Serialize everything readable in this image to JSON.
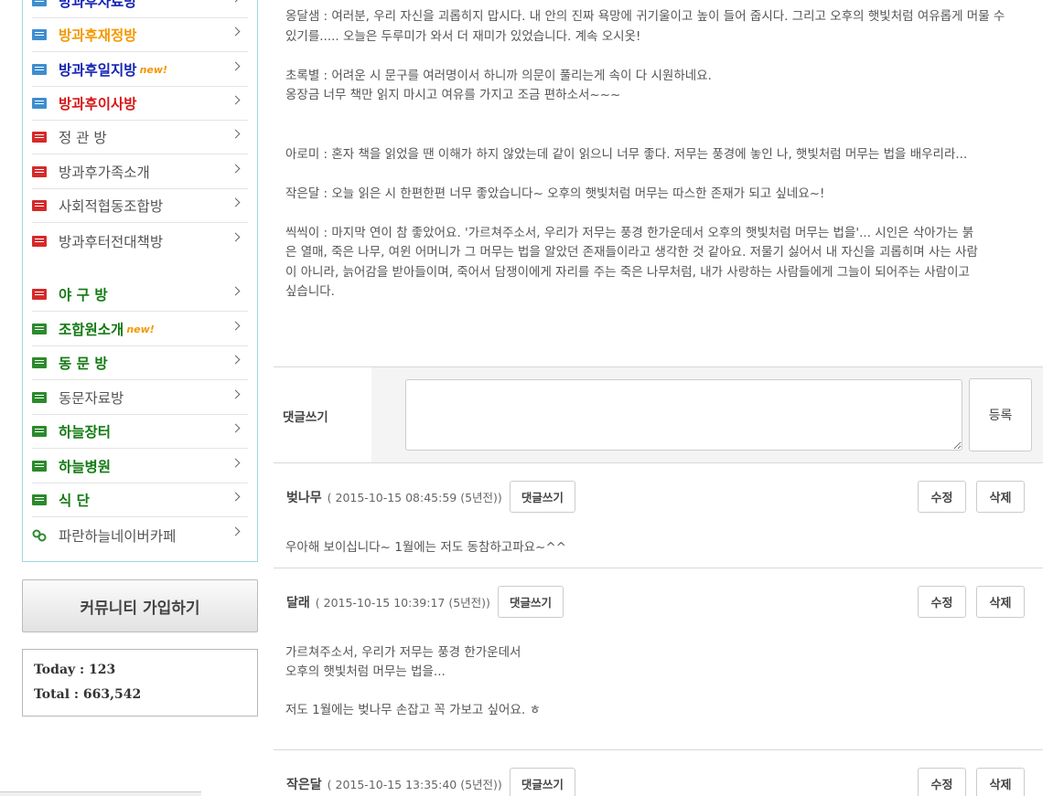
{
  "sidebar": {
    "items": [
      {
        "label": "방과후자료방",
        "style": "c-blue",
        "bold": true,
        "icon": "blue"
      },
      {
        "label": "방과후재정방",
        "style": "c-orange",
        "bold": true,
        "icon": "blue"
      },
      {
        "label": "방과후일지방",
        "style": "c-blue",
        "bold": true,
        "icon": "blue",
        "badge": "new!"
      },
      {
        "label": "방과후이사방",
        "style": "c-red",
        "bold": true,
        "icon": "blue"
      },
      {
        "label": "정 관 방",
        "style": "c-gray",
        "bold": false,
        "icon": "red"
      },
      {
        "label": "방과후가족소개",
        "style": "c-gray",
        "bold": false,
        "icon": "red"
      },
      {
        "label": "사회적협동조합방",
        "style": "c-gray",
        "bold": false,
        "icon": "red"
      },
      {
        "label": "방과후터전대책방",
        "style": "c-gray",
        "bold": false,
        "icon": "red"
      },
      {
        "label": "야 구 방",
        "style": "c-green",
        "bold": true,
        "icon": "red"
      },
      {
        "label": "조합원소개",
        "style": "c-green",
        "bold": true,
        "icon": "green",
        "badge": "new!"
      },
      {
        "label": "동 문 방",
        "style": "c-green",
        "bold": true,
        "icon": "green"
      },
      {
        "label": "동문자료방",
        "style": "c-gray",
        "bold": false,
        "icon": "green"
      },
      {
        "label": "하늘장터",
        "style": "c-green",
        "bold": true,
        "icon": "green"
      },
      {
        "label": "하늘병원",
        "style": "c-green",
        "bold": true,
        "icon": "green"
      },
      {
        "label": "식 단",
        "style": "c-green",
        "bold": true,
        "icon": "green"
      },
      {
        "label": "파란하늘네이버카페",
        "style": "c-gray",
        "bold": false,
        "icon": "link"
      }
    ],
    "join_button": "커뮤니티 가입하기",
    "stats": {
      "today": "Today : 123",
      "total": "Total : 663,542"
    }
  },
  "post": {
    "lines": [
      "옹달샘 : 여러분, 우리 자신을 괴롭히지 맙시다. 내 안의 진짜 욕망에 귀기울이고 높이 들어 줍시다. 그리고 오후의 햇빛처럼 여유롭게 머물 수",
      "있기를..... 오늘은 두루미가 와서 더 재미가 있었습니다. 계속 오시옷!",
      "",
      "초록별 : 어려운 시 문구를 여러명이서 하니까 의문이 풀리는게 속이 다 시원하네요.",
      "옹장금 너무 책만 읽지 마시고 여유를 가지고 조금 편하소서~~~",
      "",
      "",
      "아로미 : 혼자 책을 읽었을 땐 이해가 하지 않았는데 같이 읽으니 너무 좋다. 저무는 풍경에 놓인 나, 햇빛처럼 머무는 법을 배우리라...",
      "",
      "작은달 : 오늘 읽은 시 한편한편 너무 좋았습니다~ 오후의 햇빛처럼 머무는 따스한 존재가 되고 싶네요~!",
      "",
      "씩씩이 : 마지막 연이 참 좋았어요. '가르쳐주소서, 우리가 저무는 풍경 한가운데서 오후의 햇빛처럼 머무는 법을'... 시인은 삭아가는 붉",
      "은 열매, 죽은 나무, 여윈 어머니가 그 머무는 법을 알았던 존재들이라고 생각한 것 같아요. 저물기 싫어서 내 자신을 괴롭히며 사는 사람",
      "이 아니라, 늙어감을 받아들이며, 죽어서 담쟁이에게 자리를 주는 죽은 나무처럼, 내가 사랑하는 사람들에게 그늘이 되어주는 사람이고",
      "싶습니다."
    ]
  },
  "comment_form": {
    "label": "댓글쓰기",
    "submit": "등록"
  },
  "comments": [
    {
      "author": "벚나무",
      "date": "( 2015-10-15 08:45:59 (5년전))",
      "reply": "댓글쓰기",
      "edit": "수정",
      "delete": "삭제",
      "body": [
        "우아해 보이십니다~ 1월에는 저도 동참하고파요~^^"
      ]
    },
    {
      "author": "달래",
      "date": "( 2015-10-15 10:39:17 (5년전))",
      "reply": "댓글쓰기",
      "edit": "수정",
      "delete": "삭제",
      "body": [
        "가르쳐주소서, 우리가 저무는 풍경 한가운데서",
        "오후의 햇빛처럼 머무는 법을...",
        "",
        "저도 1월에는 벚나무 손잡고 꼭 가보고 싶어요. ㅎ"
      ]
    },
    {
      "author": "작은달",
      "date": "( 2015-10-15 13:35:40 (5년전))",
      "reply": "댓글쓰기",
      "edit": "수정",
      "delete": "삭제",
      "body": []
    }
  ]
}
